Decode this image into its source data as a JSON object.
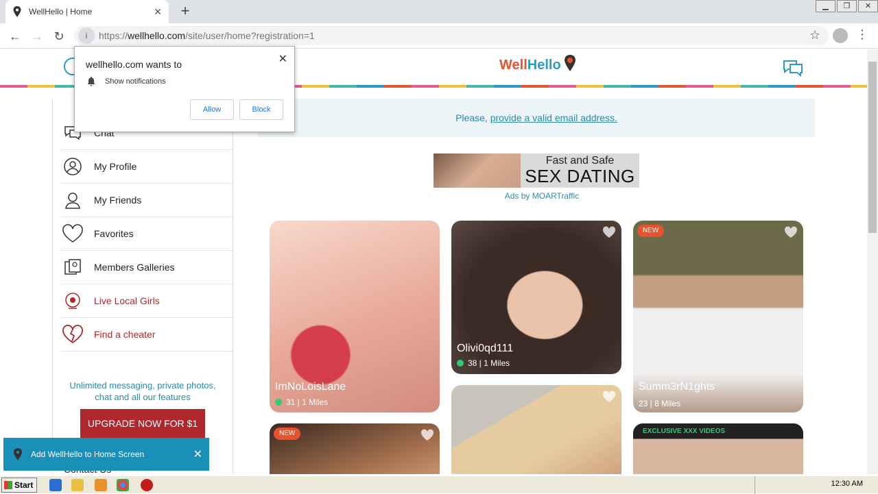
{
  "browser": {
    "tab_title": "WellHello | Home",
    "url_host": "wellhello.com",
    "url_prefix": "https://",
    "url_path": "/site/user/home?registration=1"
  },
  "permission_popup": {
    "title": "wellhello.com wants to",
    "item": "Show notifications",
    "allow": "Allow",
    "block": "Block"
  },
  "header": {
    "logo_part1": "Well",
    "logo_part2": "Hello"
  },
  "sidebar": {
    "items": [
      {
        "label": "Chat",
        "icon": "chat-icon"
      },
      {
        "label": "My Profile",
        "icon": "profile-icon"
      },
      {
        "label": "My Friends",
        "icon": "friends-icon"
      },
      {
        "label": "Favorites",
        "icon": "heart-icon"
      },
      {
        "label": "Members Galleries",
        "icon": "gallery-icon"
      },
      {
        "label": "Live Local Girls",
        "icon": "webcam-icon"
      },
      {
        "label": "Find a cheater",
        "icon": "broken-heart-icon"
      }
    ],
    "promo": "Unlimited messaging, private photos, chat and all our features",
    "upgrade": "UPGRADE NOW FOR $1",
    "contact": "Contact Us"
  },
  "notice": {
    "prefix": "Please, ",
    "link": "provide a valid email address."
  },
  "ad": {
    "line1": "Fast and Safe",
    "line2": "SEX DATING",
    "by": "Ads by MOARTraffic"
  },
  "cards": [
    {
      "name": "ImNoLoisLane",
      "meta": "31 | 1 Miles",
      "online": true
    },
    {
      "name": "Olivi0qd111",
      "meta": "38 | 1 Miles",
      "online": true
    },
    {
      "name": "Summ3rN1ghts",
      "meta": "23 | 8 Miles",
      "online": false,
      "badge": "NEW"
    },
    {
      "badge": "NEW"
    },
    {},
    {
      "badge_green": "EXCLUSIVE XXX VIDEOS"
    }
  ],
  "toast": {
    "text": "Add WellHello to Home Screen"
  },
  "taskbar": {
    "start": "Start",
    "clock": "12:30 AM"
  },
  "colors": {
    "brand_blue": "#2a9bc8",
    "brand_orange": "#e8532f",
    "accent_red": "#b0272e"
  }
}
